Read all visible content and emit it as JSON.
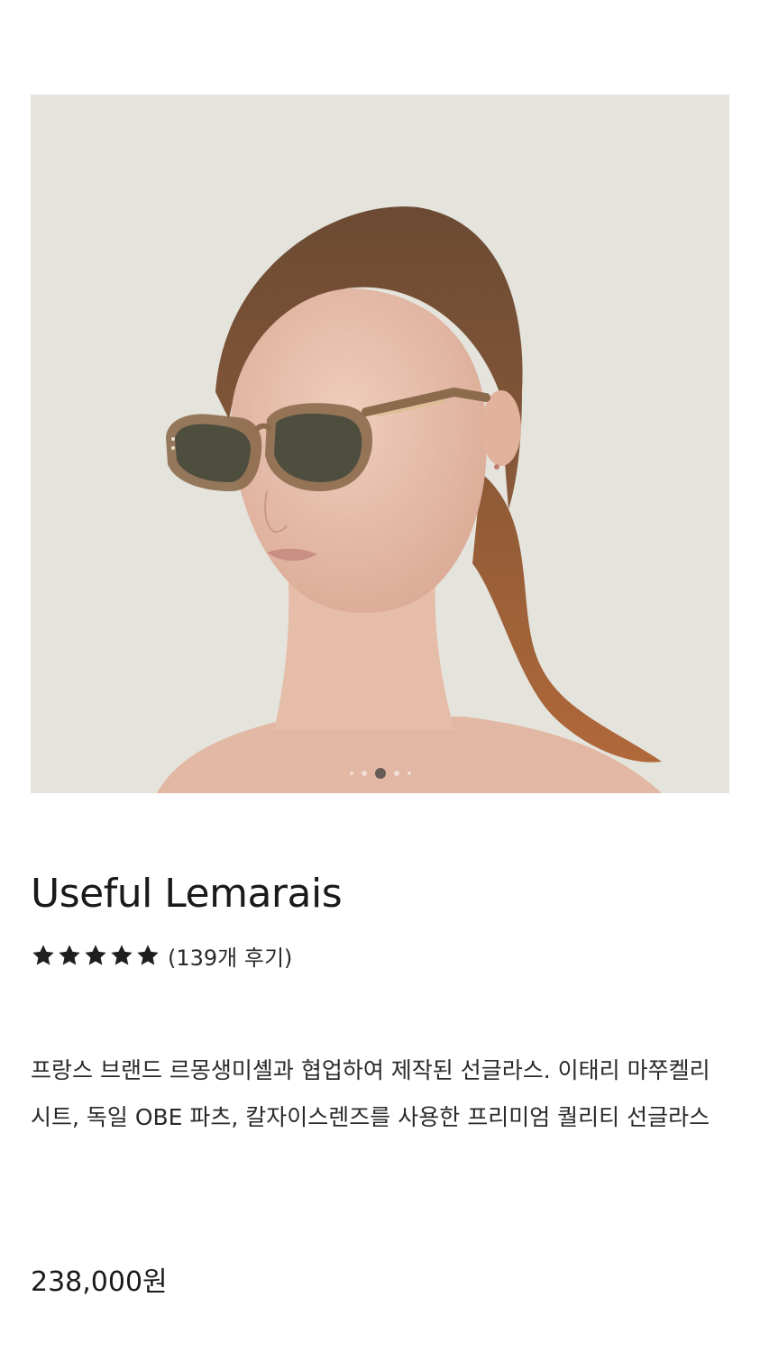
{
  "product": {
    "name": "Useful Lemarais",
    "rating": 5,
    "review_count_text": "(139개 후기)",
    "description": "프랑스 브랜드 르몽생미셸과 협업하여 제작된 선글라스. 이태리 마쭈켈리 시트, 독일 OBE 파츠, 칼자이스렌즈를 사용한 프리미엄 퀄리티 선글라스",
    "price": "238,000원"
  },
  "gallery": {
    "image_count": 5,
    "active_index": 2
  },
  "colors": {
    "star": "#1f1f1f",
    "image_background": "#e4e3dc"
  },
  "icons": {
    "rating_star": "star-icon"
  }
}
